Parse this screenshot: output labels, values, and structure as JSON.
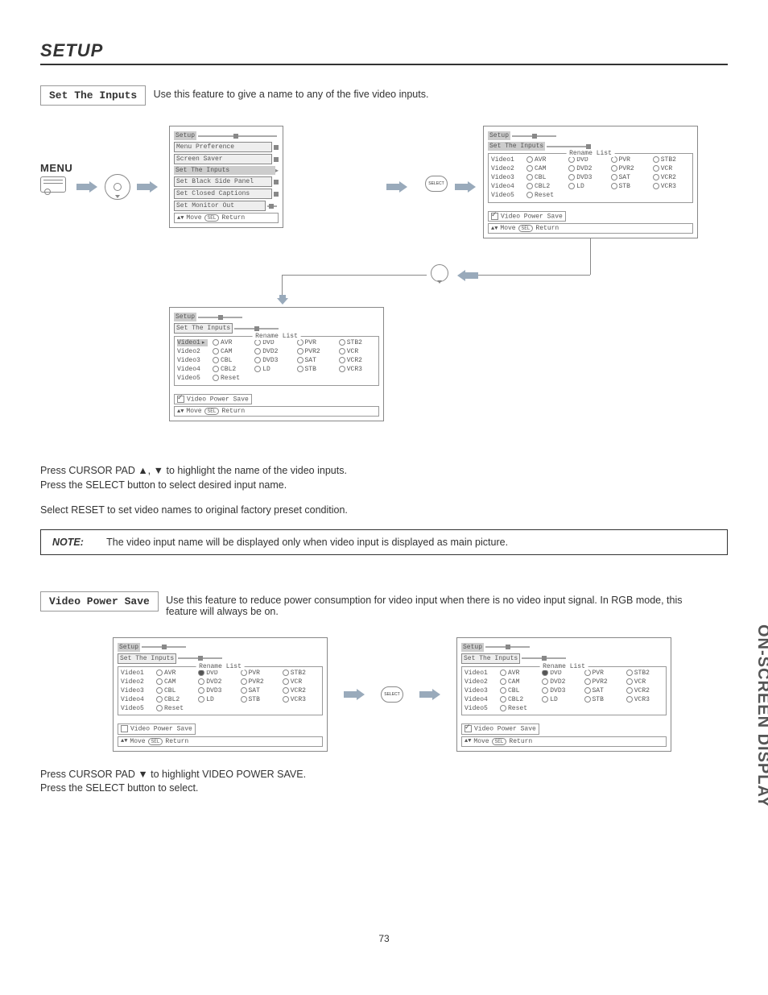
{
  "page": {
    "title": "SETUP",
    "number": "73",
    "side_tab": "ON-SCREEN DISPLAY"
  },
  "section1": {
    "label": "Set The Inputs",
    "desc": "Use this feature to give a name to any of the five video inputs.",
    "menu_label": "MENU"
  },
  "osd_setup_menu": {
    "title": "Setup",
    "items": [
      "Menu Preference",
      "Set The Inputs",
      "Screen Saver",
      "Set Black Side Panel",
      "Set Closed Captions",
      "Set Monitor Out"
    ],
    "footer_move": "Move",
    "footer_return": "Return"
  },
  "osd_inputs": {
    "title": "Setup",
    "subtitle": "Set The Inputs",
    "fieldset_label": "Rename List",
    "videos": [
      "Video1",
      "Video2",
      "Video3",
      "Video4",
      "Video5"
    ],
    "col1": [
      "AVR",
      "CAM",
      "CBL",
      "CBL2",
      "Reset"
    ],
    "col2": [
      "DVD",
      "DVD2",
      "DVD3",
      "LD"
    ],
    "col3": [
      "PVR",
      "PVR2",
      "SAT",
      "STB"
    ],
    "col4": [
      "STB2",
      "VCR",
      "VCR2",
      "VCR3"
    ],
    "vps_label": "Video Power Save",
    "footer_move": "Move",
    "footer_return": "Return"
  },
  "section1_instructions": {
    "line1": "Press CURSOR PAD ▲, ▼ to highlight the name of the video inputs.",
    "line2": "Press the SELECT button to select desired input name.",
    "line3": "Select RESET to set video names to original factory preset condition."
  },
  "note": {
    "label": "NOTE:",
    "text": "The video input name will be displayed only when video input is displayed as main picture."
  },
  "section2": {
    "label": "Video Power Save",
    "desc": "Use this feature to reduce power consumption for video input when there is no video input signal.  In RGB mode, this feature will always be on."
  },
  "section2_instructions": {
    "line1": "Press CURSOR PAD ▼ to highlight VIDEO POWER SAVE.",
    "line2": "Press the SELECT button to select."
  },
  "select_btn": "SELECT",
  "sel_pill": "SEL"
}
